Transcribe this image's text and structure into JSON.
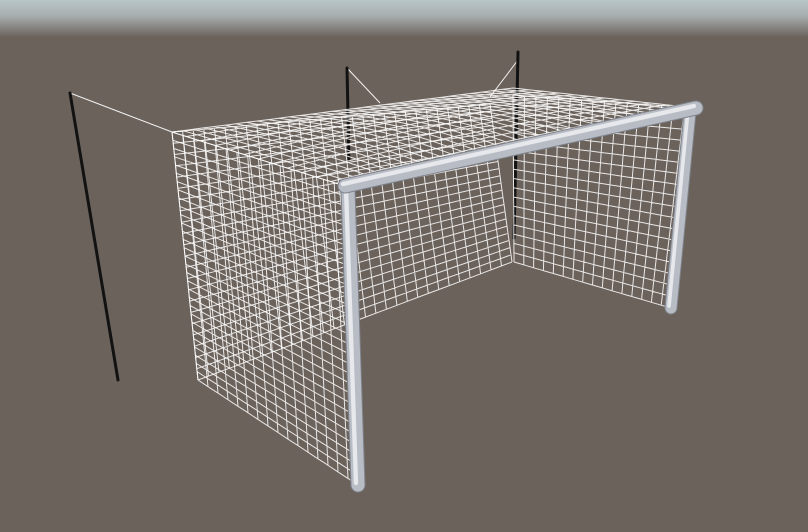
{
  "scene": {
    "subject": "soccer-goal-with-net",
    "view": "3d-perspective",
    "colors": {
      "sky_top": "#b9c6c8",
      "sky_mid": "#938f8b",
      "ground": "#6b625b",
      "post_light": "#e6e8ec",
      "post_mid": "#b8bcc4",
      "post_dark": "#7e828a",
      "net": "#ffffff",
      "support_pole": "#121212",
      "rope": "#f2f2f2"
    },
    "elements": [
      "goal-frame",
      "goal-net",
      "back-support-poles",
      "support-ropes"
    ]
  }
}
